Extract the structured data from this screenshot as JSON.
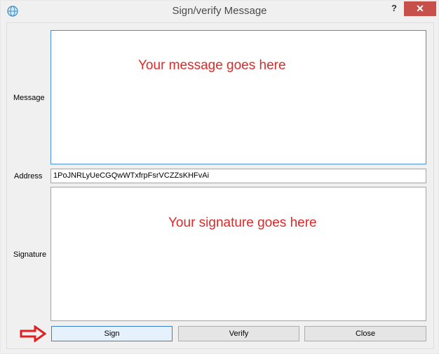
{
  "window": {
    "title": "Sign/verify Message",
    "help_label": "?",
    "close_label": "✕"
  },
  "form": {
    "message_label": "Message",
    "message_overlay": "Your message goes here",
    "address_label": "Address",
    "address_value": "1PoJNRLyUeCGQwWTxfrpFsrVCZZsKHFvAi",
    "signature_label": "Signature",
    "signature_overlay": "Your signature goes here"
  },
  "buttons": {
    "sign": "Sign",
    "verify": "Verify",
    "close": "Close"
  },
  "icons": {
    "app": "app-globe-icon",
    "arrow": "right-arrow-icon"
  },
  "colors": {
    "accent_red": "#dc2a2a",
    "close_button": "#c7504b",
    "focus_blue": "#4a8fdb"
  }
}
